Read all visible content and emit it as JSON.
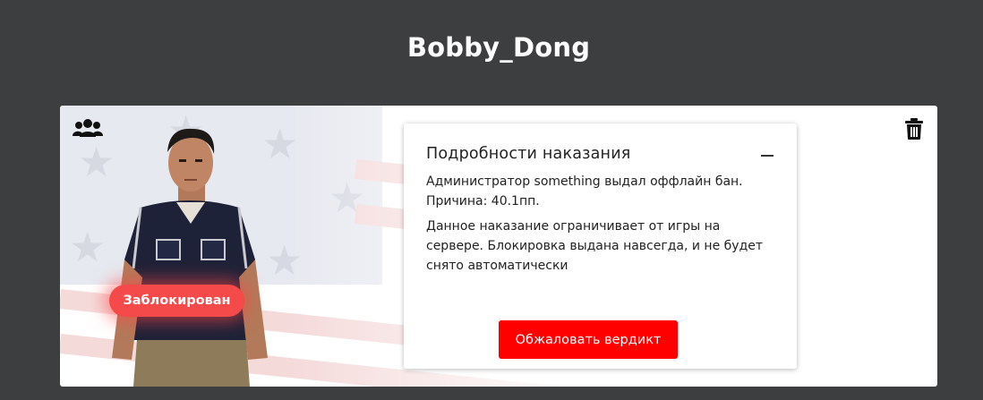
{
  "player": {
    "name": "Bobby_Dong"
  },
  "card": {
    "status_badge": "Заблокирован",
    "icons": {
      "group": "users-group-icon",
      "delete": "trash-icon"
    }
  },
  "punishment_panel": {
    "title": "Подробности наказания",
    "collapse_icon": "minus-icon",
    "lines": [
      "Администратор something выдал оффлайн бан. Причина: 40.1пп.",
      "Данное наказание ограничивает от игры на сервере. Блокировка выдана навсегда, и не будет снято автоматически"
    ],
    "appeal_button": "Обжаловать вердикт"
  },
  "colors": {
    "page_background": "#3d3e40",
    "card_background": "#ffffff",
    "badge": "#f44a4a",
    "button": "#ff0000"
  }
}
